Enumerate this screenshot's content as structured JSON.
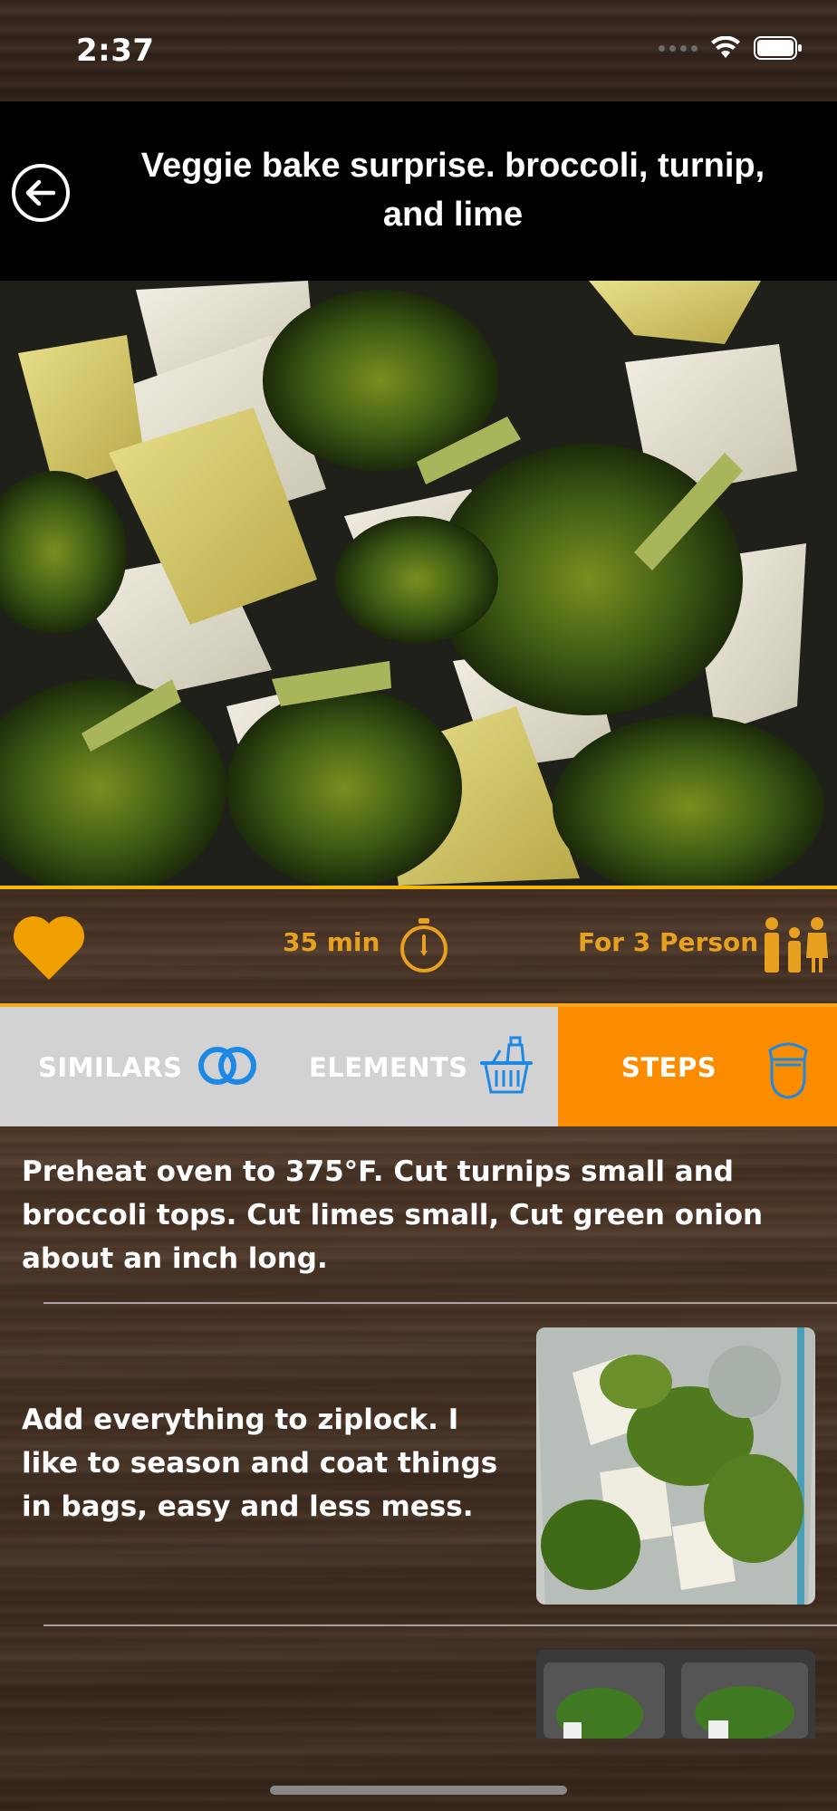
{
  "status_bar": {
    "time": "2:37"
  },
  "header": {
    "title": "Veggie bake surprise. broccoli, turnip, and lime"
  },
  "meta": {
    "duration": "35 min",
    "servings": "For 3 Person"
  },
  "tabs": [
    {
      "label": "SIMILARS",
      "active": false
    },
    {
      "label": "ELEMENTS",
      "active": false
    },
    {
      "label": "STEPS",
      "active": true
    }
  ],
  "steps": [
    {
      "text": "Preheat oven to 375°F. Cut turnips small and broccoli tops. Cut limes small, Cut green onion about an inch long."
    },
    {
      "text": "Add everything to ziplock. I like to season and coat things in bags, easy and less mess."
    }
  ],
  "colors": {
    "accent_orange": "#fb8c00",
    "accent_gold": "#e8a020",
    "tab_bg": "#d2d2d2",
    "icon_blue": "#1e88e5"
  }
}
